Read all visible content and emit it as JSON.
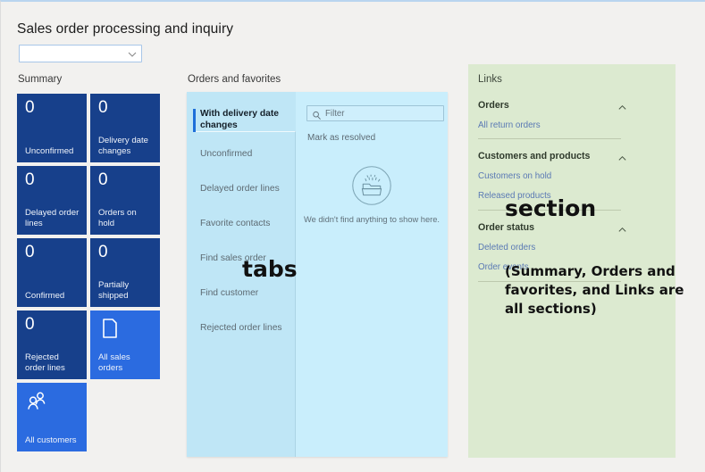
{
  "header": {
    "title": "Sales order processing and inquiry",
    "dropdown": {
      "value": "",
      "icon": "chevron-down-icon"
    }
  },
  "summary": {
    "caption": "Summary",
    "tiles": [
      {
        "num": "0",
        "label": "Unconfirmed",
        "kind": "count"
      },
      {
        "num": "0",
        "label": "Delivery date changes",
        "kind": "count"
      },
      {
        "num": "0",
        "label": "Delayed order lines",
        "kind": "count"
      },
      {
        "num": "0",
        "label": "Orders on hold",
        "kind": "count"
      },
      {
        "num": "0",
        "label": "Confirmed",
        "kind": "count"
      },
      {
        "num": "0",
        "label": "Partially shipped",
        "kind": "count"
      },
      {
        "num": "0",
        "label": "Rejected order lines",
        "kind": "count"
      },
      {
        "num": "",
        "label": "All sales orders",
        "kind": "action",
        "icon": "document-icon"
      },
      {
        "num": "",
        "label": "All customers",
        "kind": "action",
        "icon": "people-icon"
      }
    ],
    "colors": {
      "count_tile": "#17408b",
      "action_tile": "#2b6be0"
    }
  },
  "orders": {
    "caption": "Orders and favorites",
    "tabs": [
      {
        "label": "With delivery date changes",
        "active": true
      },
      {
        "label": "Unconfirmed",
        "active": false
      },
      {
        "label": "Delayed order lines",
        "active": false
      },
      {
        "label": "Favorite contacts",
        "active": false
      },
      {
        "label": "Find sales order",
        "active": false
      },
      {
        "label": "Find customer",
        "active": false
      },
      {
        "label": "Rejected order lines",
        "active": false
      }
    ],
    "filter": {
      "placeholder": "Filter",
      "value": "",
      "icon": "search-icon"
    },
    "command": "Mark as resolved",
    "empty_message": "We didn't find anything to show here.",
    "empty_icon": "empty-folder-icon",
    "colors": {
      "panel": "#c9eefc",
      "tab_column": "#bfe6f6",
      "active_indicator": "#1e6fd9"
    }
  },
  "links": {
    "caption": "Links",
    "groups": [
      {
        "title": "Orders",
        "collapse_icon": "chevron-up-icon",
        "items": [
          "All return orders"
        ]
      },
      {
        "title": "Customers and products",
        "collapse_icon": "chevron-up-icon",
        "items": [
          "Customers on hold",
          "Released products"
        ]
      },
      {
        "title": "Order status",
        "collapse_icon": "chevron-up-icon",
        "items": [
          "Deleted orders",
          "Order events"
        ]
      }
    ],
    "colors": {
      "panel": "#dcead0",
      "link_text": "#5a79b4"
    }
  },
  "annotations": {
    "tabs": "tabs",
    "section": "section",
    "sections_note": "(Summary, Orders and favorites, and Links are all sections)"
  }
}
